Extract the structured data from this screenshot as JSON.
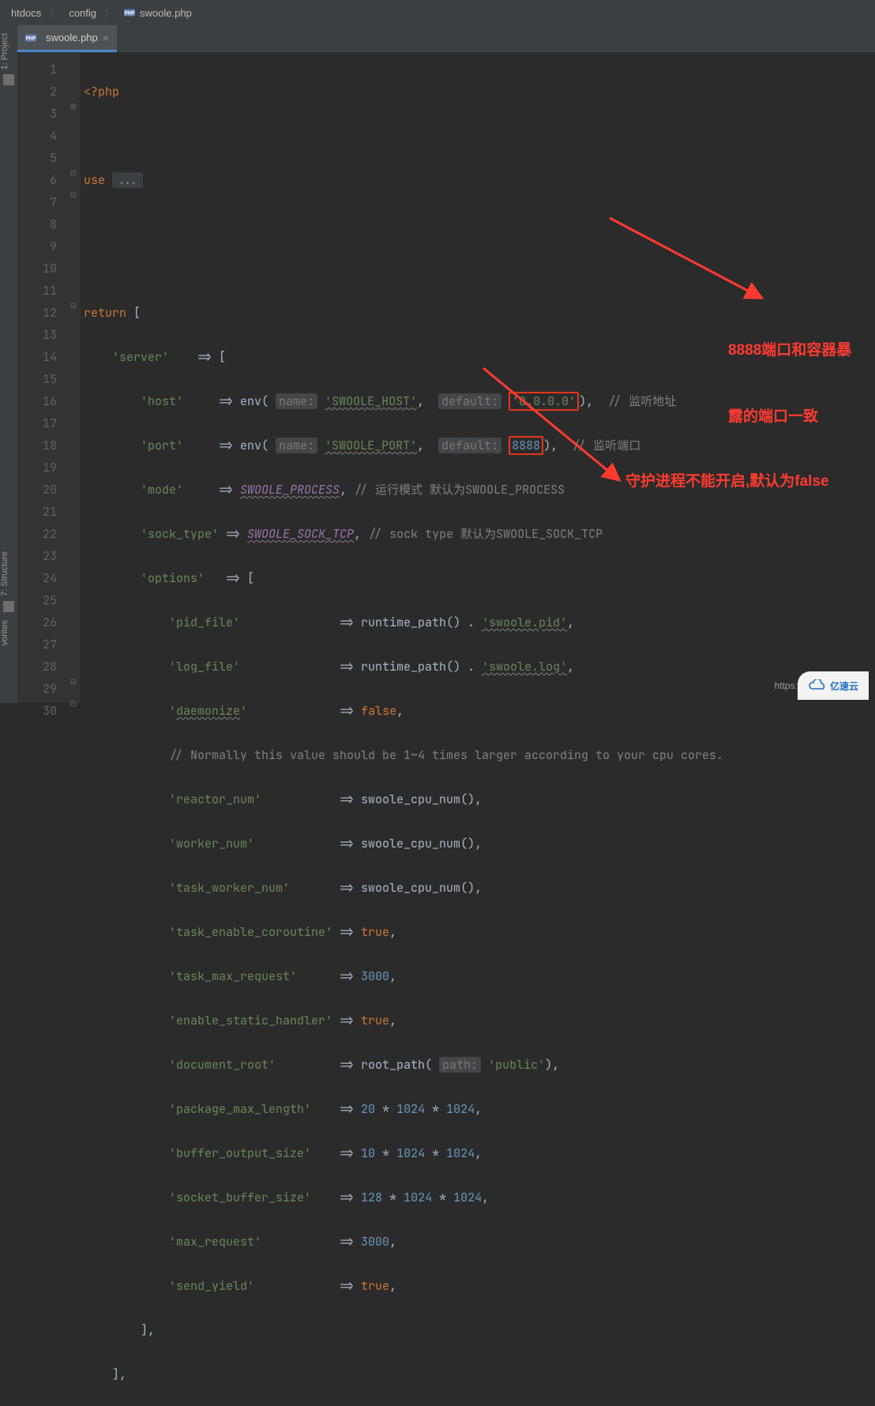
{
  "breadcrumbs": [
    "htdocs",
    "config",
    "swoole.php"
  ],
  "tab": {
    "label": "swoole.php"
  },
  "tool_windows": {
    "project": "1: Project",
    "structure": "7: Structure",
    "favorites": "vorites"
  },
  "gutter": {
    "start": 1,
    "end": 30
  },
  "hints": {
    "name": "name:",
    "default": "default:",
    "path": "path:"
  },
  "code": {
    "l1": "<?php",
    "l3_kw": "use ",
    "l3_fold": "...",
    "l6_kw": "return ",
    "l6_tail": "[",
    "l7_key": "'server'",
    "l7_arrow": "    => [",
    "l8_key": "'host'",
    "l8_arrow": "     => ",
    "l8_fn": "env",
    "l8_arg1": "'SWOOLE_HOST'",
    "l8_arg2": "'0.0.0.0'",
    "l8_tail": "),  ",
    "l8_cmt": "// 监听地址",
    "l9_key": "'port'",
    "l9_arrow": "     => ",
    "l9_fn": "env",
    "l9_arg1": "'SWOOLE_PORT'",
    "l9_arg2": "8888",
    "l9_tail": "),  ",
    "l9_cmt": "// 监听端口",
    "l10_key": "'mode'",
    "l10_arrow": "     => ",
    "l10_c": "SWOOLE_PROCESS",
    "l10_tail": ", ",
    "l10_cmt": "// 运行模式 默认为SWOOLE_PROCESS",
    "l11_key": "'sock_type'",
    "l11_arrow": " => ",
    "l11_c": "SWOOLE_SOCK_TCP",
    "l11_tail": ", ",
    "l11_cmt": "// sock type 默认为SWOOLE_SOCK_TCP",
    "l12_key": "'options'",
    "l12_arrow": "   => [",
    "l13_key": "'pid_file'",
    "l13_fn": "runtime_path",
    "l13_tail": "() . ",
    "l13_str": "'swoole.pid'",
    "l14_key": "'log_file'",
    "l14_fn": "runtime_path",
    "l14_tail": "() . ",
    "l14_str": "'swoole.log'",
    "l15_key_q": "'",
    "l15_key_w": "daemonize",
    "l15_val": "false",
    "l16_cmt": "// Normally this value should be 1~4 times larger according to your cpu cores.",
    "l17_key": "'reactor_num'",
    "l17_fn": "swoole_cpu_num",
    "l18_key": "'worker_num'",
    "l18_fn": "swoole_cpu_num",
    "l19_key": "'task_worker_num'",
    "l19_fn": "swoole_cpu_num",
    "l20_key": "'task_enable_coroutine'",
    "l20_val": "true",
    "l21_key": "'task_max_request'",
    "l21_val": "3000",
    "l22_key": "'enable_static_handler'",
    "l22_val": "true",
    "l23_key": "'document_root'",
    "l23_fn": "root_path",
    "l23_str": "'public'",
    "l24_key": "'package_max_length'",
    "l24_a": "20",
    "l24_b": "1024",
    "l24_c": "1024",
    "l25_key": "'buffer_output_size'",
    "l25_a": "10",
    "l25_b": "1024",
    "l25_c": "1024",
    "l26_key": "'socket_buffer_size'",
    "l26_a": "128",
    "l26_b": "1024",
    "l26_c": "1024",
    "l27_key": "'max_request'",
    "l27_val": "3000",
    "l28_key": "'send_yield'",
    "l28_val": "true",
    "l29": "],",
    "l30": "],"
  },
  "annotations": {
    "a1_l1": "8888端口和容器暴",
    "a1_l2": "露的端口一致",
    "a2": "守护进程不能开启,默认为false"
  },
  "watermark": "https://blog.csdn.net/q",
  "logo_text": "亿速云"
}
